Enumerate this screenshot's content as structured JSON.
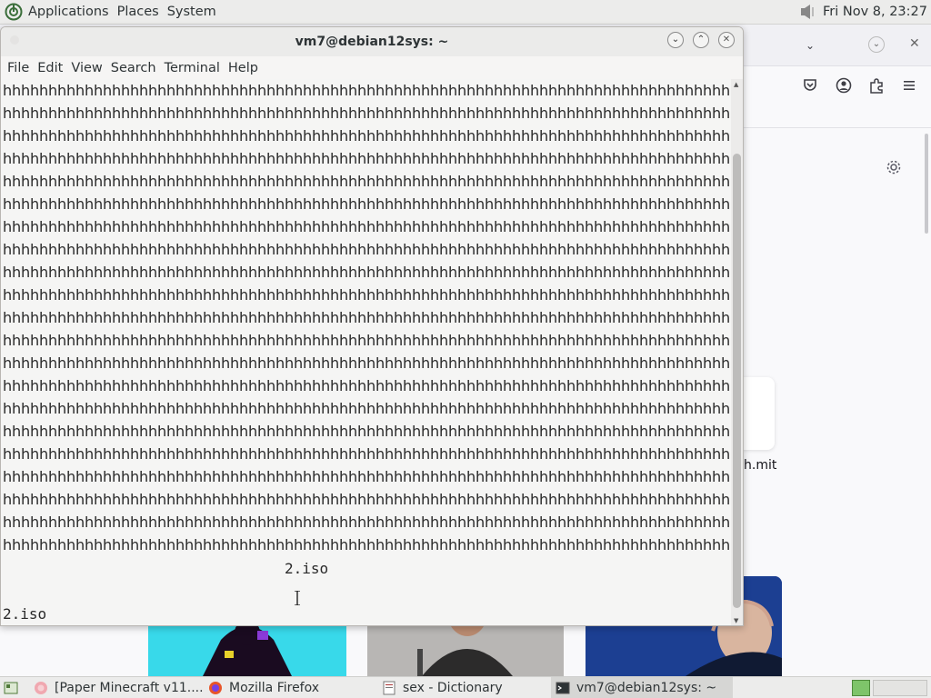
{
  "top_panel": {
    "menus": [
      "Applications",
      "Places",
      "System"
    ],
    "clock": "Fri Nov 8, 23:27"
  },
  "firefox": {
    "shortcut_label": "h.mit",
    "toolbar_icons": [
      "pocket-icon",
      "account-icon",
      "extensions-icon",
      "menu-icon"
    ]
  },
  "terminal": {
    "title": "vm7@debian12sys: ~",
    "menu": [
      "File",
      "Edit",
      "View",
      "Search",
      "Terminal",
      "Help"
    ],
    "repeat_line": "hhhhhhhhhhhhhhhhhhhhhhhhhhhhhhhhhhhhhhhhhhhhhhhhhhhhhhhhhhhhhhhhhhhhhhhhhhhhhhhhhhhhhhhhhhhhhhhhhhhhhhhhhh",
    "line_count": 21,
    "trailing_1": "2.iso",
    "trailing_2": "2.iso"
  },
  "taskbar": {
    "tasks": [
      "[Paper Minecraft v11....",
      "Mozilla Firefox",
      "sex - Dictionary",
      "vm7@debian12sys: ~"
    ]
  }
}
